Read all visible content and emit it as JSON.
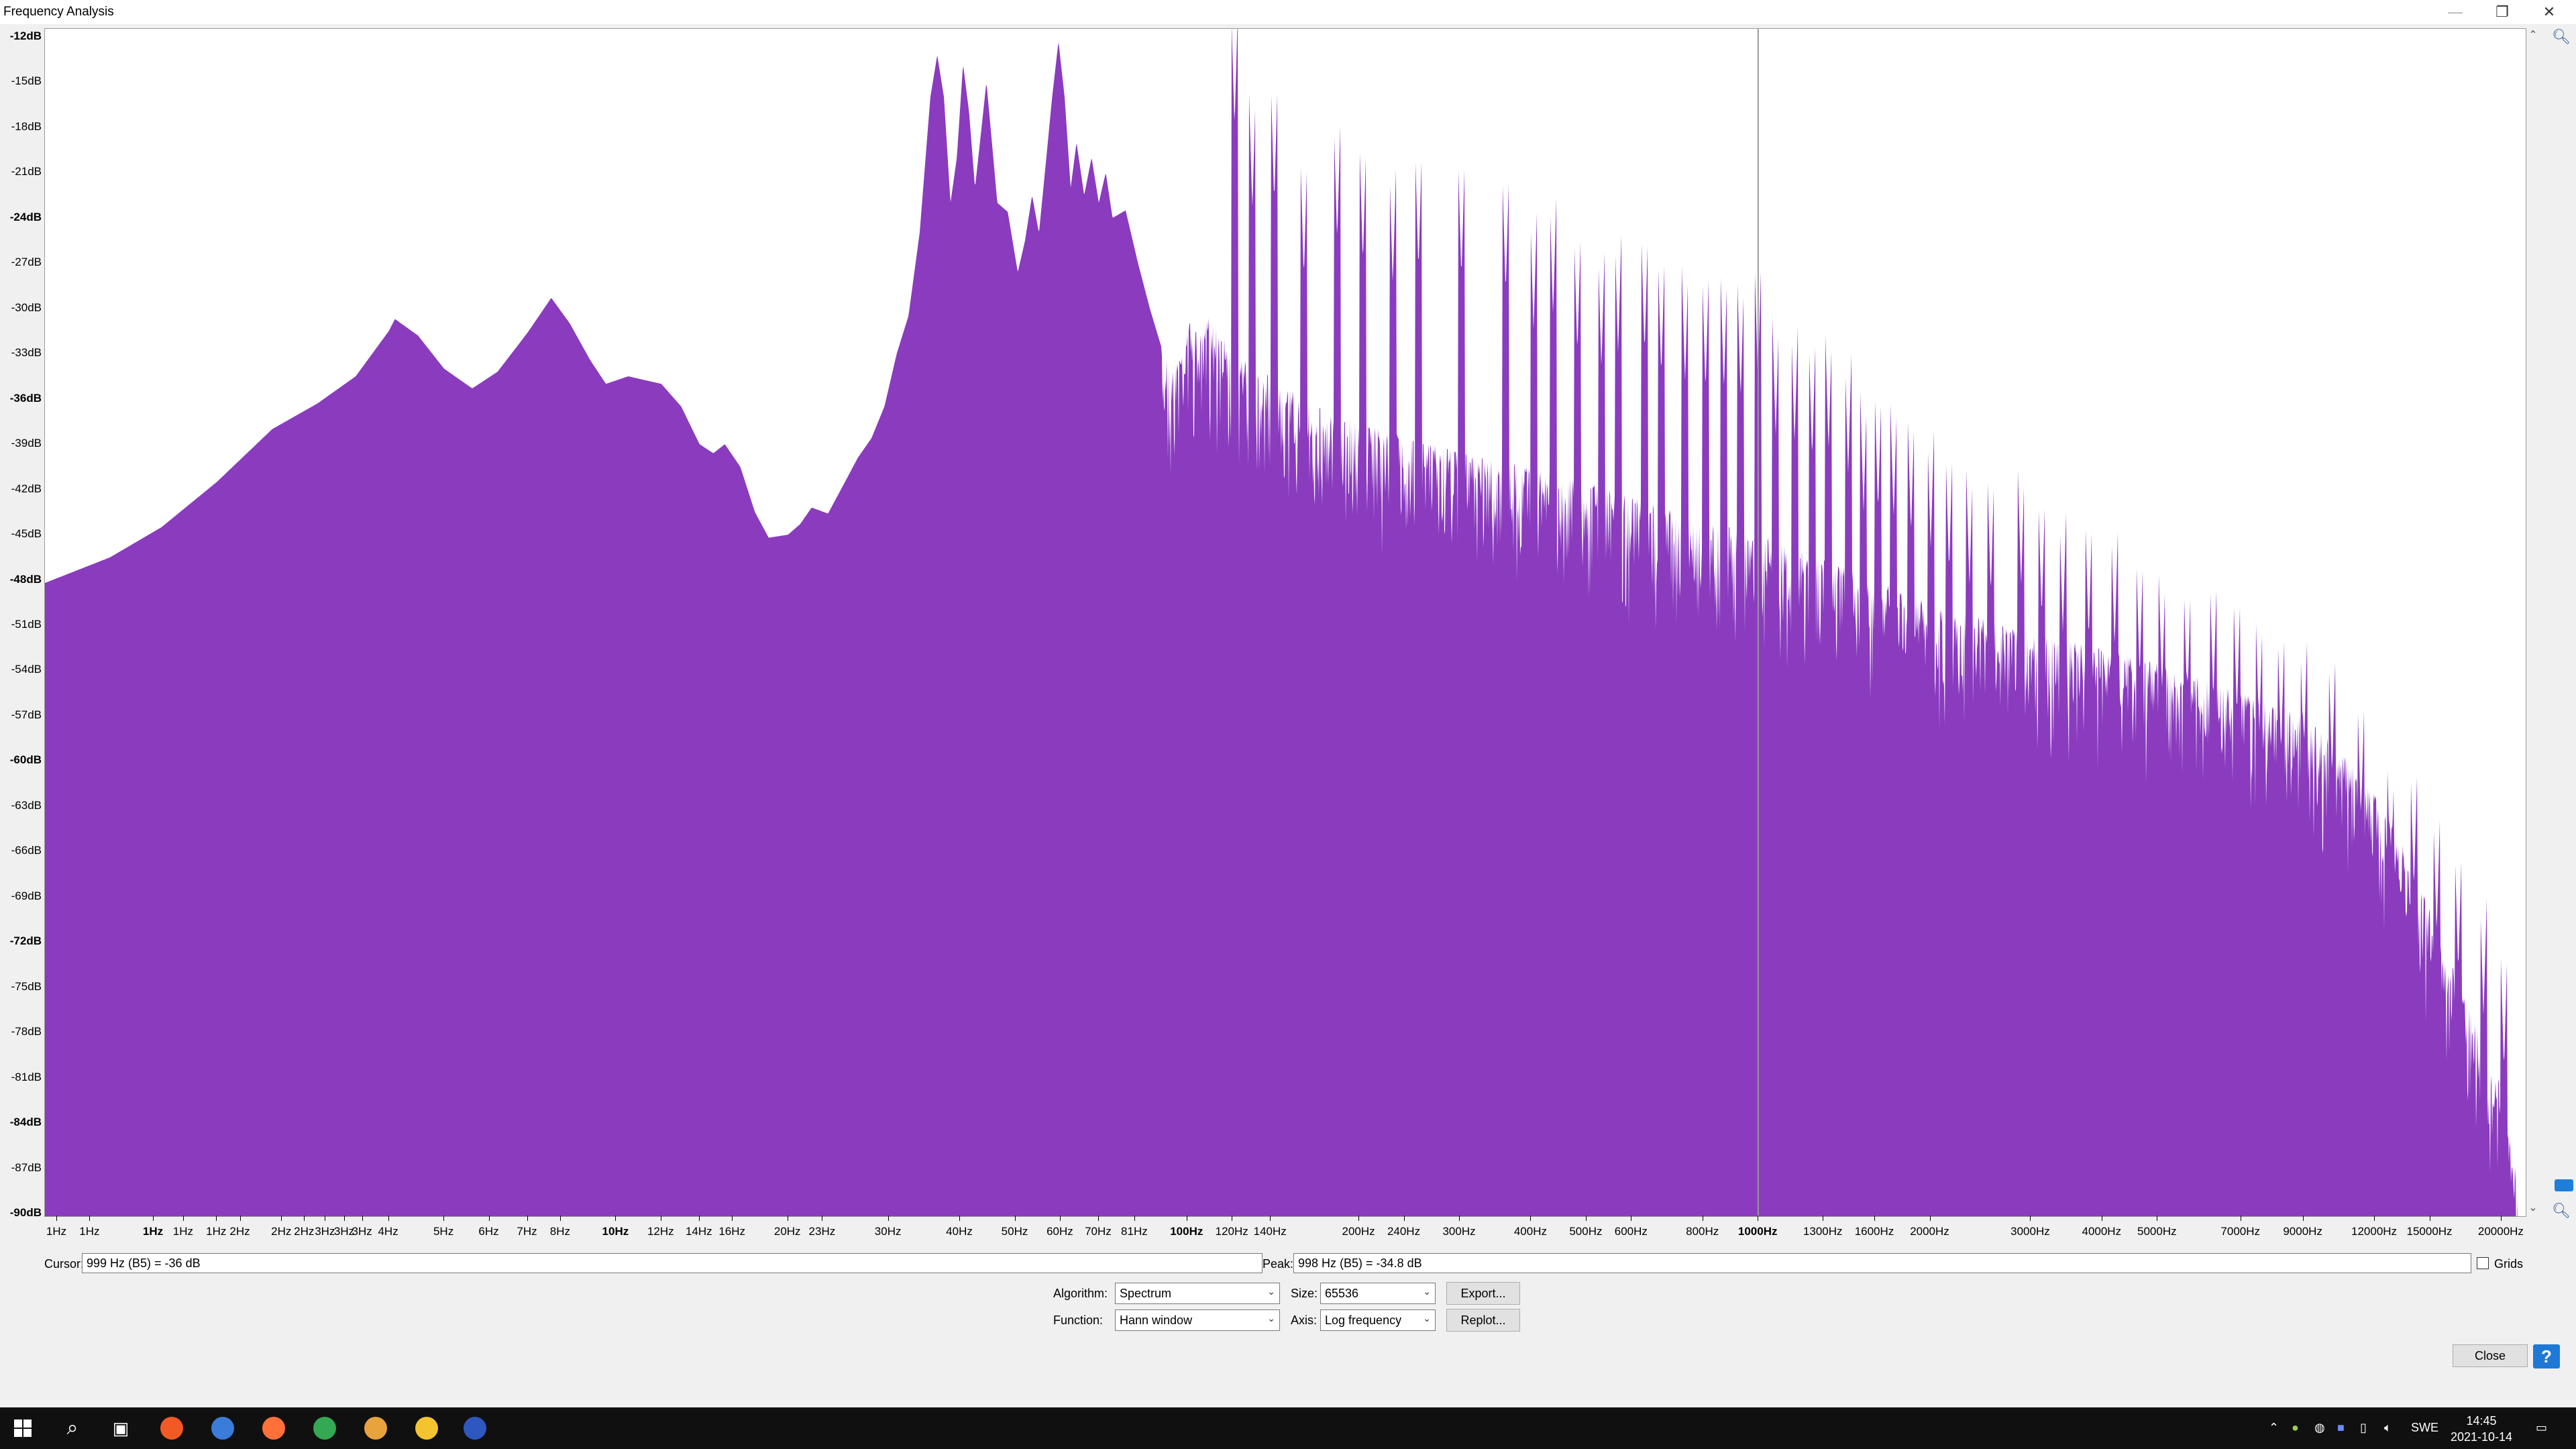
{
  "window": {
    "title": "Frequency Analysis",
    "min": "—",
    "restore": "❐",
    "close": "✕"
  },
  "chart_data": {
    "type": "area",
    "title": "",
    "xlabel": "",
    "ylabel": "",
    "x_scale": "log",
    "xlim_hz": [
      1,
      22050
    ],
    "ylim_db": [
      -90,
      -12
    ],
    "color": "#8a3bbe",
    "cursor_line_hz": 999,
    "y_ticks": [
      "-12dB",
      "-15dB",
      "-18dB",
      "-21dB",
      "-24dB",
      "-27dB",
      "-30dB",
      "-33dB",
      "-36dB",
      "-39dB",
      "-42dB",
      "-45dB",
      "-48dB",
      "-51dB",
      "-54dB",
      "-57dB",
      "-60dB",
      "-63dB",
      "-66dB",
      "-69dB",
      "-72dB",
      "-75dB",
      "-78dB",
      "-81dB",
      "-84dB",
      "-87dB",
      "-90dB"
    ],
    "y_tick_bold": [
      "-12dB",
      "-24dB",
      "-36dB",
      "-48dB",
      "-60dB",
      "-72dB",
      "-84dB",
      "-90dB"
    ],
    "x_ticks": [
      {
        "hz": 1.05,
        "label": "1Hz"
      },
      {
        "hz": 1.2,
        "label": "1Hz"
      },
      {
        "hz": 1.55,
        "label": "1Hz",
        "bold": true
      },
      {
        "hz": 1.75,
        "label": "1Hz"
      },
      {
        "hz": 2.0,
        "label": "1Hz"
      },
      {
        "hz": 2.2,
        "label": "2Hz"
      },
      {
        "hz": 2.6,
        "label": "2Hz"
      },
      {
        "hz": 2.85,
        "label": "2Hz"
      },
      {
        "hz": 3.1,
        "label": "3Hz"
      },
      {
        "hz": 3.35,
        "label": "3Hz"
      },
      {
        "hz": 3.6,
        "label": "3Hz"
      },
      {
        "hz": 4.0,
        "label": "4Hz"
      },
      {
        "hz": 5.0,
        "label": "5Hz"
      },
      {
        "hz": 6.0,
        "label": "6Hz"
      },
      {
        "hz": 7.0,
        "label": "7Hz"
      },
      {
        "hz": 8.0,
        "label": "8Hz"
      },
      {
        "hz": 10,
        "label": "10Hz",
        "bold": true
      },
      {
        "hz": 12,
        "label": "12Hz"
      },
      {
        "hz": 14,
        "label": "14Hz"
      },
      {
        "hz": 16,
        "label": "16Hz"
      },
      {
        "hz": 20,
        "label": "20Hz"
      },
      {
        "hz": 23,
        "label": "23Hz"
      },
      {
        "hz": 30,
        "label": "30Hz"
      },
      {
        "hz": 40,
        "label": "40Hz"
      },
      {
        "hz": 50,
        "label": "50Hz"
      },
      {
        "hz": 60,
        "label": "60Hz"
      },
      {
        "hz": 70,
        "label": "70Hz"
      },
      {
        "hz": 81,
        "label": "81Hz"
      },
      {
        "hz": 100,
        "label": "100Hz",
        "bold": true
      },
      {
        "hz": 120,
        "label": "120Hz"
      },
      {
        "hz": 140,
        "label": "140Hz"
      },
      {
        "hz": 200,
        "label": "200Hz"
      },
      {
        "hz": 240,
        "label": "240Hz"
      },
      {
        "hz": 300,
        "label": "300Hz"
      },
      {
        "hz": 400,
        "label": "400Hz"
      },
      {
        "hz": 500,
        "label": "500Hz"
      },
      {
        "hz": 600,
        "label": "600Hz"
      },
      {
        "hz": 800,
        "label": "800Hz"
      },
      {
        "hz": 1000,
        "label": "1000Hz",
        "bold": true
      },
      {
        "hz": 1300,
        "label": "1300Hz"
      },
      {
        "hz": 1600,
        "label": "1600Hz"
      },
      {
        "hz": 2000,
        "label": "2000Hz"
      },
      {
        "hz": 3000,
        "label": "3000Hz"
      },
      {
        "hz": 4000,
        "label": "4000Hz"
      },
      {
        "hz": 5000,
        "label": "5000Hz"
      },
      {
        "hz": 7000,
        "label": "7000Hz"
      },
      {
        "hz": 9000,
        "label": "9000Hz"
      },
      {
        "hz": 12000,
        "label": "12000Hz"
      },
      {
        "hz": 15000,
        "label": "15000Hz"
      },
      {
        "hz": 20000,
        "label": "20000Hz"
      }
    ],
    "envelope": [
      [
        1.0,
        -48.2
      ],
      [
        1.3,
        -46.5
      ],
      [
        1.6,
        -44.5
      ],
      [
        2.0,
        -41.5
      ],
      [
        2.5,
        -38.0
      ],
      [
        3.0,
        -36.3
      ],
      [
        3.5,
        -34.5
      ],
      [
        4.0,
        -31.5
      ],
      [
        4.1,
        -30.7
      ],
      [
        4.5,
        -31.8
      ],
      [
        5.0,
        -34.0
      ],
      [
        5.6,
        -35.3
      ],
      [
        6.2,
        -34.2
      ],
      [
        7.0,
        -31.6
      ],
      [
        7.7,
        -29.3
      ],
      [
        8.3,
        -31.0
      ],
      [
        9.0,
        -33.4
      ],
      [
        9.6,
        -35.0
      ],
      [
        10.5,
        -34.5
      ],
      [
        12.0,
        -35.0
      ],
      [
        13.0,
        -36.5
      ],
      [
        14.0,
        -39.0
      ],
      [
        14.8,
        -39.6
      ],
      [
        15.5,
        -39.0
      ],
      [
        16.5,
        -40.5
      ],
      [
        17.5,
        -43.5
      ],
      [
        18.5,
        -45.2
      ],
      [
        20.0,
        -45.0
      ],
      [
        21.0,
        -44.3
      ],
      [
        22.0,
        -43.2
      ],
      [
        23.5,
        -43.6
      ],
      [
        25.0,
        -41.7
      ],
      [
        26.5,
        -39.9
      ],
      [
        28.0,
        -38.6
      ],
      [
        29.5,
        -36.5
      ],
      [
        31.0,
        -33.0
      ],
      [
        32.5,
        -30.5
      ],
      [
        34.0,
        -25.0
      ],
      [
        35.5,
        -16.0
      ],
      [
        36.5,
        -13.2
      ],
      [
        37.5,
        -16.0
      ],
      [
        38.5,
        -23.0
      ],
      [
        39.5,
        -20.0
      ],
      [
        40.5,
        -13.8
      ],
      [
        41.5,
        -17.0
      ],
      [
        42.5,
        -22.0
      ],
      [
        43.5,
        -18.5
      ],
      [
        44.5,
        -15.0
      ],
      [
        45.5,
        -19.0
      ],
      [
        46.5,
        -23.0
      ],
      [
        48.5,
        -23.6
      ],
      [
        50.5,
        -27.6
      ],
      [
        52.0,
        -25.5
      ],
      [
        53.5,
        -22.5
      ],
      [
        55.0,
        -25.0
      ],
      [
        56.5,
        -20.5
      ],
      [
        58.0,
        -16.0
      ],
      [
        59.5,
        -12.3
      ],
      [
        61.0,
        -16.0
      ],
      [
        62.5,
        -22.0
      ],
      [
        64.0,
        -19.0
      ],
      [
        66.0,
        -22.5
      ],
      [
        68.0,
        -20.0
      ],
      [
        70.0,
        -23.0
      ],
      [
        72.0,
        -21.0
      ],
      [
        74.0,
        -24.0
      ],
      [
        78.0,
        -23.5
      ],
      [
        82.0,
        -27.0
      ],
      [
        86.0,
        -30.0
      ],
      [
        90.0,
        -32.5
      ],
      [
        95.0,
        -34.0
      ],
      [
        100.0,
        -30.5
      ],
      [
        105.0,
        -32.0
      ],
      [
        110.0,
        -30.0
      ],
      [
        120.0,
        -33.0
      ],
      [
        140.0,
        -34.5
      ],
      [
        160.0,
        -36.0
      ],
      [
        180.0,
        -37.0
      ],
      [
        200.0,
        -37.5
      ],
      [
        240.0,
        -38.5
      ],
      [
        300.0,
        -39.5
      ],
      [
        400.0,
        -40.5
      ],
      [
        500.0,
        -41.5
      ],
      [
        600.0,
        -42.5
      ],
      [
        800.0,
        -44.0
      ],
      [
        1000.0,
        -45.0
      ],
      [
        1300.0,
        -46.5
      ],
      [
        1600.0,
        -48.0
      ],
      [
        2000.0,
        -49.5
      ],
      [
        3000.0,
        -51.5
      ],
      [
        4000.0,
        -52.5
      ],
      [
        5000.0,
        -53.5
      ],
      [
        6000.0,
        -54.5
      ],
      [
        7000.0,
        -55.5
      ],
      [
        9000.0,
        -57.0
      ],
      [
        10000.0,
        -58.5
      ],
      [
        12000.0,
        -62.0
      ],
      [
        14000.0,
        -67.0
      ],
      [
        16000.0,
        -72.5
      ],
      [
        18000.0,
        -77.5
      ],
      [
        20000.0,
        -81.5
      ],
      [
        21000.0,
        -86.0
      ],
      [
        21500.0,
        -90.0
      ]
    ],
    "harmonic_peaks": [
      [
        121,
        -18.0
      ],
      [
        130,
        -23.5
      ],
      [
        142,
        -23.0
      ],
      [
        160,
        -28.0
      ],
      [
        183,
        -25.5
      ],
      [
        203,
        -27.0
      ],
      [
        229,
        -28.5
      ],
      [
        254,
        -27.5
      ],
      [
        302,
        -28.0
      ],
      [
        361,
        -29.0
      ],
      [
        404,
        -31.5
      ],
      [
        437,
        -30.5
      ],
      [
        482,
        -33.0
      ],
      [
        531,
        -34.0
      ],
      [
        568,
        -33.0
      ],
      [
        632,
        -33.0
      ],
      [
        676,
        -34.5
      ],
      [
        744,
        -35.0
      ],
      [
        808,
        -35.5
      ],
      [
        870,
        -35.5
      ],
      [
        931,
        -36.0
      ],
      [
        998,
        -34.8
      ],
      [
        1072,
        -38.5
      ],
      [
        1157,
        -39.0
      ],
      [
        1242,
        -40.0
      ],
      [
        1327,
        -39.5
      ],
      [
        1436,
        -41.0
      ],
      [
        1528,
        -43.5
      ],
      [
        1620,
        -43.5
      ],
      [
        1725,
        -44.0
      ],
      [
        1850,
        -45.0
      ],
      [
        2003,
        -46.0
      ],
      [
        2157,
        -47.5
      ],
      [
        2342,
        -48.5
      ],
      [
        2552,
        -49.0
      ],
      [
        2884,
        -48.5
      ],
      [
        3133,
        -50.5
      ],
      [
        3412,
        -51.5
      ],
      [
        3787,
        -52.0
      ],
      [
        4204,
        -52.5
      ],
      [
        4651,
        -54.5
      ],
      [
        5090,
        -55.5
      ],
      [
        5635,
        -56.5
      ],
      [
        6260,
        -56.0
      ],
      [
        6883,
        -57.0
      ],
      [
        7530,
        -58.5
      ],
      [
        8225,
        -59.5
      ],
      [
        9010,
        -60.0
      ],
      [
        10100,
        -61.0
      ],
      [
        11350,
        -64.0
      ],
      [
        12800,
        -68.5
      ],
      [
        14050,
        -68.5
      ],
      [
        15400,
        -71.5
      ],
      [
        16800,
        -74.0
      ],
      [
        18600,
        -77.0
      ],
      [
        20200,
        -80.5
      ]
    ]
  },
  "cursor": {
    "label": "Cursor:",
    "value": "999 Hz (B5) = -36 dB"
  },
  "peak": {
    "label": "Peak:",
    "value": "998 Hz (B5) = -34.8 dB"
  },
  "grids": {
    "label": "Grids",
    "checked": false
  },
  "algorithm": {
    "label": "Algorithm:",
    "value": "Spectrum"
  },
  "size": {
    "label": "Size:",
    "value": "65536"
  },
  "function": {
    "label": "Function:",
    "value": "Hann window"
  },
  "axis": {
    "label": "Axis:",
    "value": "Log frequency"
  },
  "buttons": {
    "export": "Export...",
    "replot": "Replot...",
    "close": "Close",
    "help": "?"
  },
  "taskbar": {
    "icons": [
      "windows-start-icon",
      "search-icon",
      "task-view-icon",
      "brave-browser-icon",
      "firefox-dev-icon",
      "firefox-icon",
      "chrome-icon",
      "chrome-canary-icon",
      "file-explorer-icon",
      "audacity-icon"
    ],
    "icon_colors": [
      "#ffffff",
      "#ffffff",
      "#ffffff",
      "#f15a24",
      "#3b7bd9",
      "#ff7139",
      "#34a853",
      "#e8a33d",
      "#f4c430",
      "#2f57c0"
    ],
    "language": "SWE",
    "time": "14:45",
    "date": "2021-10-14"
  }
}
